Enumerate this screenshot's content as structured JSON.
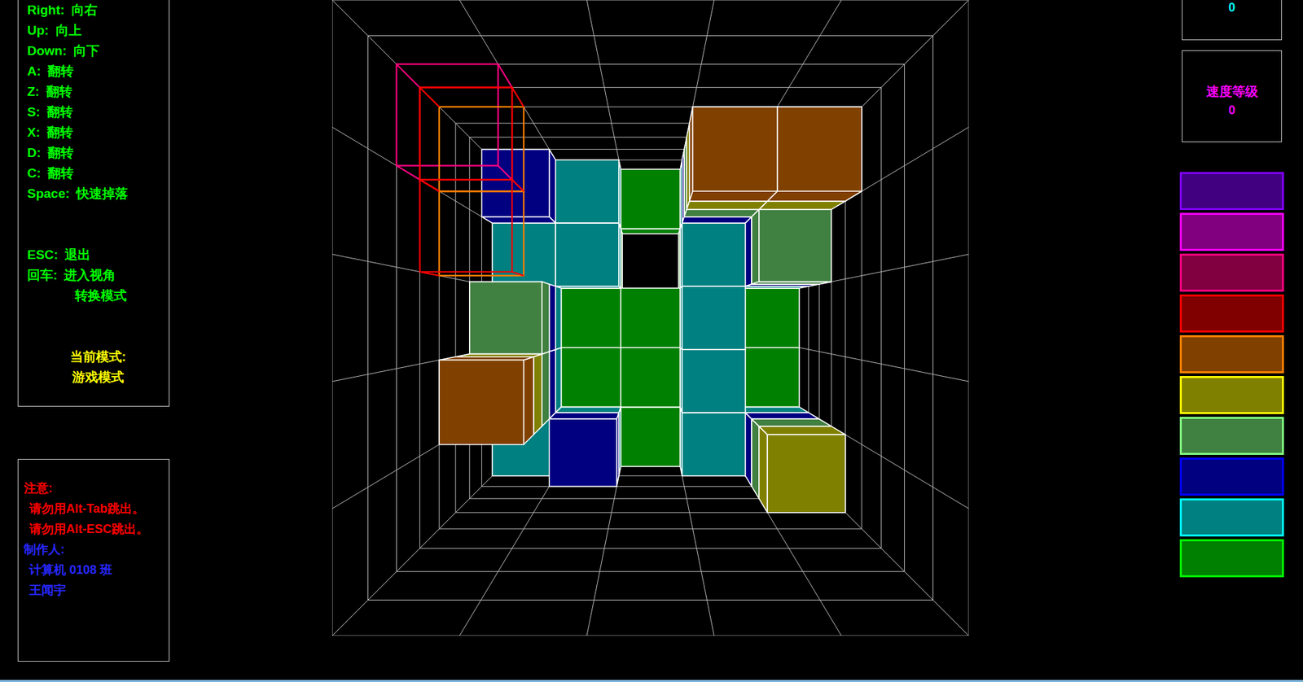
{
  "controls": [
    {
      "key": "Right:",
      "action": "向右"
    },
    {
      "key": "Up:",
      "action": "向上"
    },
    {
      "key": "Down:",
      "action": "向下"
    },
    {
      "key": "A:",
      "action": "翻转"
    },
    {
      "key": "Z:",
      "action": "翻转"
    },
    {
      "key": "S:",
      "action": "翻转"
    },
    {
      "key": "X:",
      "action": "翻转"
    },
    {
      "key": "D:",
      "action": "翻转"
    },
    {
      "key": "C:",
      "action": "翻转"
    },
    {
      "key": "Space:",
      "action": "快速掉落"
    }
  ],
  "system_keys": [
    {
      "key": "ESC:",
      "action": "退出"
    },
    {
      "key": "回车:",
      "action": "进入视角",
      "continuation": "转换模式"
    }
  ],
  "mode": {
    "label": "当前模式:",
    "value": "游戏模式"
  },
  "notice": {
    "title": "注意:",
    "lines": [
      "请勿用Alt-Tab跳出。",
      "请勿用Alt-ESC跳出。"
    ]
  },
  "author": {
    "label": "制作人:",
    "lines": [
      "计算机 0108 班",
      "王闻宇"
    ]
  },
  "score": {
    "value": "0"
  },
  "speed": {
    "label": "速度等级",
    "value": "0"
  },
  "depth_legend": [
    {
      "color": "#400080",
      "border_color": "#8000ff"
    },
    {
      "color": "#800080",
      "border_color": "#ff00ff"
    },
    {
      "color": "#800040",
      "border_color": "#ff0080"
    },
    {
      "color": "#800000",
      "border_color": "#ff0000"
    },
    {
      "color": "#804000",
      "border_color": "#ff8000"
    },
    {
      "color": "#808000",
      "border_color": "#ffff00"
    },
    {
      "color": "#408040",
      "border_color": "#80ff80"
    },
    {
      "color": "#000080",
      "border_color": "#0000ff"
    },
    {
      "color": "#008080",
      "border_color": "#00ffff"
    },
    {
      "color": "#008000",
      "border_color": "#00ff00"
    }
  ],
  "well": {
    "columns": 5,
    "rows": 5,
    "depth": 10,
    "heights": [
      [
        3,
        2,
        1,
        6,
        6
      ],
      [
        2,
        2,
        0,
        2,
        4
      ],
      [
        4,
        1,
        1,
        2,
        1
      ],
      [
        6,
        1,
        1,
        2,
        1
      ],
      [
        2,
        3,
        1,
        2,
        5
      ]
    ]
  },
  "falling_piece": {
    "cubes": [
      {
        "col": 0,
        "row": 0,
        "layer": 7
      },
      {
        "col": 0,
        "row": 0,
        "layer": 6
      },
      {
        "col": 0,
        "row": 1,
        "layer": 6
      }
    ]
  }
}
